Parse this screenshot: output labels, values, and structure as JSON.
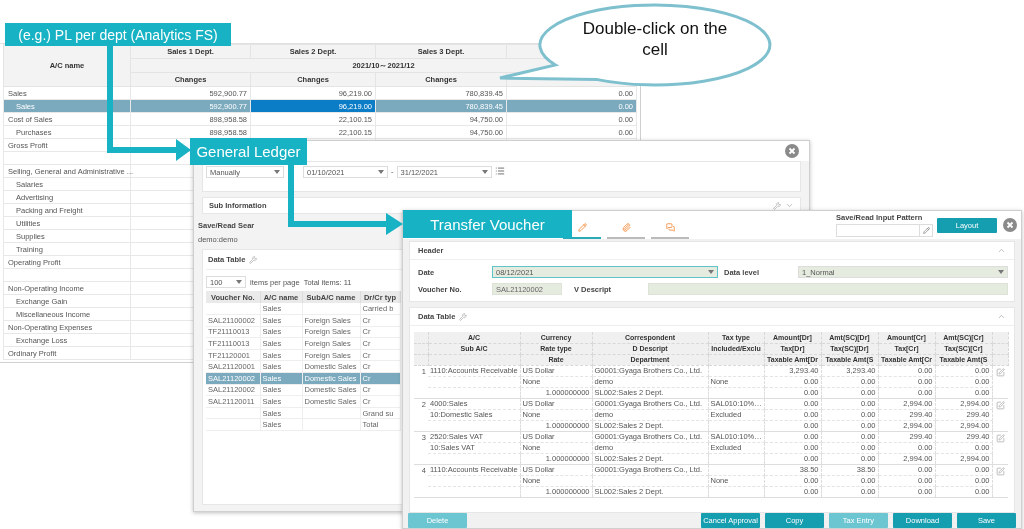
{
  "callouts": [
    {
      "kind": "label",
      "text": "(e.g.) PL per dept (Analytics FS)"
    },
    {
      "kind": "label",
      "text": "General Ledger"
    },
    {
      "kind": "label",
      "text": "Transfer Voucher"
    },
    {
      "kind": "bubble",
      "text": "Double-click on the cell"
    }
  ],
  "pl_report": {
    "columns": {
      "account_header": "A/C name",
      "departments": [
        "Sales 1 Dept.",
        "Sales 2 Dept.",
        "Sales 3 Dept."
      ],
      "period": "2021/10～2021/12",
      "measures": [
        "Changes",
        "Changes",
        "Changes"
      ]
    },
    "rows": [
      {
        "kind": "account",
        "name": "Sales",
        "selected": false,
        "cells": [
          {
            "value": "592,900.77",
            "selected": false
          },
          {
            "value": "96,219.00",
            "selected": false
          },
          {
            "value": "780,839.45",
            "selected": false
          },
          {
            "value": "0.00",
            "selected": false
          }
        ],
        "children": [
          {
            "kind": "account",
            "name": "Sales",
            "selected": true,
            "cells": [
              {
                "value": "592,900.77",
                "selected": false
              },
              {
                "value": "96,219.00",
                "selected": true
              },
              {
                "value": "780,839.45",
                "selected": false
              },
              {
                "value": "0.00",
                "selected": false
              }
            ]
          }
        ]
      },
      {
        "kind": "account",
        "name": "Cost of Sales",
        "selected": false,
        "cells": [
          {
            "value": "898,958.58",
            "selected": false
          },
          {
            "value": "22,100.15",
            "selected": false
          },
          {
            "value": "94,750.00",
            "selected": false
          },
          {
            "value": "0.00",
            "selected": false
          }
        ],
        "children": [
          {
            "kind": "account",
            "name": "Purchases",
            "selected": false,
            "cells": [
              {
                "value": "898,958.58",
                "selected": false
              },
              {
                "value": "22,100.15",
                "selected": false
              },
              {
                "value": "94,750.00",
                "selected": false
              },
              {
                "value": "0.00",
                "selected": false
              }
            ]
          }
        ]
      },
      {
        "kind": "account",
        "name": "Gross Profit",
        "selected": false
      },
      {
        "kind": "blank"
      },
      {
        "kind": "account",
        "name": "Selling, General and Administrative ...",
        "selected": false,
        "children": [
          {
            "kind": "account",
            "name": "Salaries",
            "selected": false
          },
          {
            "kind": "account",
            "name": "Advertising",
            "selected": false
          },
          {
            "kind": "account",
            "name": "Packing and Freight",
            "selected": false
          },
          {
            "kind": "account",
            "name": "Utilities",
            "selected": false
          },
          {
            "kind": "account",
            "name": "Supplies",
            "selected": false
          },
          {
            "kind": "account",
            "name": "Training",
            "selected": false
          }
        ]
      },
      {
        "kind": "account",
        "name": "Operating Profit",
        "selected": false
      },
      {
        "kind": "blank"
      },
      {
        "kind": "account",
        "name": "Non-Operating Income",
        "selected": false,
        "children": [
          {
            "kind": "account",
            "name": "Exchange Gain",
            "selected": false
          },
          {
            "kind": "account",
            "name": "Miscellaneous Income",
            "selected": false
          }
        ]
      },
      {
        "kind": "account",
        "name": "Non-Operating Expenses",
        "selected": false,
        "children": [
          {
            "kind": "account",
            "name": "Exchange Loss",
            "selected": false
          }
        ]
      },
      {
        "kind": "account",
        "name": "Ordinary Profit",
        "selected": false
      }
    ]
  },
  "general_ledger": {
    "filter": {
      "mode": "Manually",
      "from": "01/10/2021",
      "separator": "-",
      "to": "31/12/2021"
    },
    "sub_information": "Sub Information",
    "search_pattern": {
      "label": "Save/Read Sear",
      "value": "demo:demo"
    },
    "data_table": {
      "title": "Data Table",
      "page_size": "100",
      "page_size_label": "items per page",
      "total": "Total items: 11",
      "columns": [
        "Voucher No.",
        "A/C name",
        "SubA/C name",
        "Dr/Cr typ"
      ],
      "rows": [
        {
          "account": "Sales",
          "dr_cr": "Carried b",
          "selected": false
        },
        {
          "voucher": "SAL21100002",
          "account": "Sales",
          "sub_account": "Foreign Sales",
          "dr_cr": "Cr",
          "selected": false
        },
        {
          "voucher": "TF21110013",
          "account": "Sales",
          "sub_account": "Foreign Sales",
          "dr_cr": "Cr",
          "selected": false
        },
        {
          "voucher": "TF21110013",
          "account": "Sales",
          "sub_account": "Foreign Sales",
          "dr_cr": "Cr",
          "selected": false
        },
        {
          "voucher": "TF21120001",
          "account": "Sales",
          "sub_account": "Foreign Sales",
          "dr_cr": "Cr",
          "selected": false
        },
        {
          "voucher": "SAL21120001",
          "account": "Sales",
          "sub_account": "Domestic Sales",
          "dr_cr": "Cr",
          "selected": false
        },
        {
          "voucher": "SAL21120002",
          "account": "Sales",
          "sub_account": "Domestic Sales",
          "dr_cr": "Cr",
          "selected": true
        },
        {
          "voucher": "SAL21120002",
          "account": "Sales",
          "sub_account": "Domestic Sales",
          "dr_cr": "Cr",
          "selected": false
        },
        {
          "voucher": "SAL21120011",
          "account": "Sales",
          "sub_account": "Domestic Sales",
          "dr_cr": "Cr",
          "selected": false
        },
        {
          "account": "Sales",
          "dr_cr": "Grand su",
          "selected": false
        },
        {
          "account": "Sales",
          "dr_cr": "Total",
          "selected": false
        }
      ]
    }
  },
  "transfer_voucher": {
    "tabs": [
      {
        "kind": "edit",
        "selected": true
      },
      {
        "kind": "attachment",
        "selected": false
      },
      {
        "kind": "comment",
        "selected": false
      }
    ],
    "input_pattern": {
      "label": "Save/Read Input Pattern"
    },
    "layout_button": "Layout",
    "header": {
      "title": "Header",
      "fields": [
        {
          "label": "Date",
          "value": "08/12/2021",
          "kind": "select",
          "focused": true
        },
        {
          "label": "Data level",
          "value": "1_Normal",
          "kind": "select",
          "focused": false
        },
        {
          "label": "Voucher No.",
          "value": "SAL21120002",
          "kind": "text",
          "focused": false
        },
        {
          "label": "V Descript",
          "kind": "text",
          "focused": false
        }
      ]
    },
    "data_table": {
      "title": "Data Table",
      "header_lines": [
        {
          "account": "A/C",
          "currency": "Currency",
          "correspondent": "Correspondent",
          "tax": "Tax type",
          "amount_dr": "Amount[Dr]",
          "amount_sc_dr": "Amt(SC)[Dr]",
          "amount_cr": "Amount[Cr]",
          "amount_sc_cr": "Amt(SC)[Cr]"
        },
        {
          "account": "Sub A/C",
          "currency": "Rate type",
          "correspondent": "D Descript",
          "tax": "Included/Exclu",
          "amount_dr": "Tax[Dr]",
          "amount_sc_dr": "Tax(SC)[Dr]",
          "amount_cr": "Tax[Cr]",
          "amount_sc_cr": "Tax(SC)[Cr]"
        },
        {
          "currency": "Rate",
          "correspondent": "Department",
          "amount_dr": "Taxable Amt[Dr",
          "amount_sc_dr": "Taxable Amt(S",
          "amount_cr": "Taxable Amt[Cr",
          "amount_sc_cr": "Taxable Amt(S"
        }
      ],
      "entries": [
        {
          "number": "1",
          "lines": [
            {
              "account": "1110:Accounts Receivable",
              "currency": "US Dollar",
              "correspondent": "G0001:Gyaga Brothers Co., Ltd.",
              "amount_dr": "3,293.40",
              "amount_sc_dr": "3,293.40",
              "amount_cr": "0.00",
              "amount_sc_cr": "0.00"
            },
            {
              "currency": "None",
              "correspondent": "demo",
              "tax": "None",
              "amount_dr": "0.00",
              "amount_sc_dr": "0.00",
              "amount_cr": "0.00",
              "amount_sc_cr": "0.00"
            },
            {
              "currency": "1.000000000",
              "correspondent": "SL002:Sales 2 Dept.",
              "amount_dr": "0.00",
              "amount_sc_dr": "0.00",
              "amount_cr": "0.00",
              "amount_sc_cr": "0.00"
            }
          ]
        },
        {
          "number": "2",
          "lines": [
            {
              "account": "4000:Sales",
              "currency": "US Dollar",
              "correspondent": "G0001:Gyaga Brothers Co., Ltd.",
              "tax": "SAL010:10%…",
              "amount_dr": "0.00",
              "amount_sc_dr": "0.00",
              "amount_cr": "2,994.00",
              "amount_sc_cr": "2,994.00"
            },
            {
              "account": "10:Domestic Sales",
              "currency": "None",
              "correspondent": "demo",
              "tax": "Excluded",
              "amount_dr": "0.00",
              "amount_sc_dr": "0.00",
              "amount_cr": "299.40",
              "amount_sc_cr": "299.40"
            },
            {
              "currency": "1.000000000",
              "correspondent": "SL002:Sales 2 Dept.",
              "amount_dr": "0.00",
              "amount_sc_dr": "0.00",
              "amount_cr": "2,994.00",
              "amount_sc_cr": "2,994.00"
            }
          ]
        },
        {
          "number": "3",
          "lines": [
            {
              "account": "2520:Sales VAT",
              "currency": "US Dollar",
              "correspondent": "G0001:Gyaga Brothers Co., Ltd.",
              "tax": "SAL010:10%…",
              "amount_dr": "0.00",
              "amount_sc_dr": "0.00",
              "amount_cr": "299.40",
              "amount_sc_cr": "299.40"
            },
            {
              "account": "10:Sales VAT",
              "currency": "None",
              "correspondent": "demo",
              "tax": "Excluded",
              "amount_dr": "0.00",
              "amount_sc_dr": "0.00",
              "amount_cr": "0.00",
              "amount_sc_cr": "0.00"
            },
            {
              "currency": "1.000000000",
              "correspondent": "SL002:Sales 2 Dept.",
              "amount_dr": "0.00",
              "amount_sc_dr": "0.00",
              "amount_cr": "2,994.00",
              "amount_sc_cr": "2,994.00"
            }
          ]
        },
        {
          "number": "4",
          "lines": [
            {
              "account": "1110:Accounts Receivable",
              "currency": "US Dollar",
              "correspondent": "G0001:Gyaga Brothers Co., Ltd.",
              "amount_dr": "38.50",
              "amount_sc_dr": "38.50",
              "amount_cr": "0.00",
              "amount_sc_cr": "0.00"
            },
            {
              "currency": "None",
              "tax": "None",
              "amount_dr": "0.00",
              "amount_sc_dr": "0.00",
              "amount_cr": "0.00",
              "amount_sc_cr": "0.00"
            },
            {
              "currency": "1.000000000",
              "correspondent": "SL002:Sales 2 Dept.",
              "amount_dr": "0.00",
              "amount_sc_dr": "0.00",
              "amount_cr": "0.00",
              "amount_sc_cr": "0.00"
            }
          ]
        }
      ]
    },
    "left_buttons": [
      {
        "label": "Delete",
        "disabled": true
      }
    ],
    "right_buttons": [
      {
        "label": "Cancel Approval",
        "disabled": false
      },
      {
        "label": "Copy",
        "disabled": false
      },
      {
        "label": "Tax Entry",
        "disabled": true
      },
      {
        "label": "Download",
        "disabled": false
      },
      {
        "label": "Save",
        "disabled": false
      }
    ]
  }
}
